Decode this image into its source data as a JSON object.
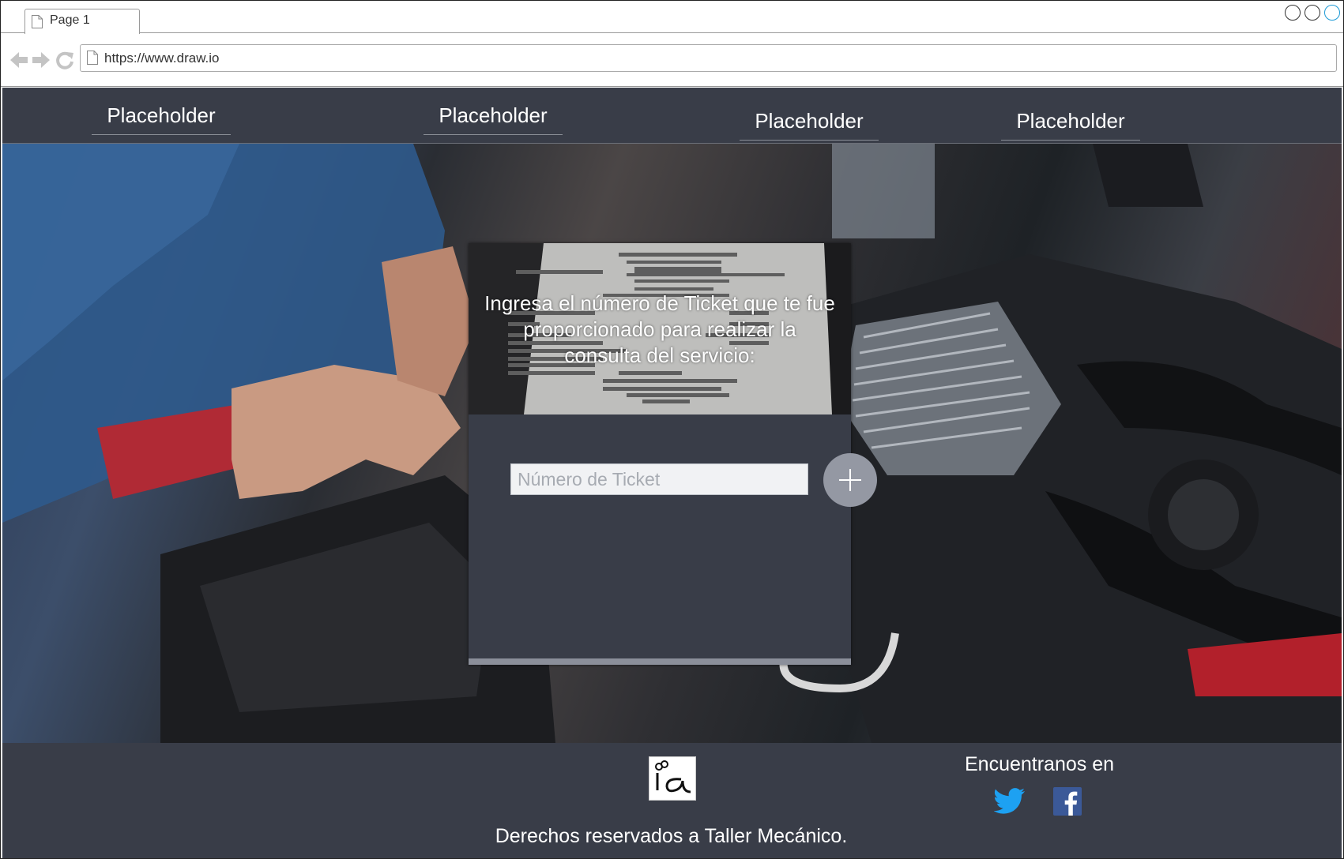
{
  "browser": {
    "tab_label": "Page 1",
    "url": "https://www.draw.io"
  },
  "nav": {
    "items": [
      "Placeholder",
      "Placeholder",
      "Placeholder",
      "Placeholder"
    ]
  },
  "card": {
    "title": "Ingresa el número de Ticket que te fue proporcionado para realizar la consulta del servicio:",
    "input_placeholder": "Número de Ticket",
    "add_icon": "plus-icon"
  },
  "footer": {
    "find_us": "Encuentranos en",
    "social": [
      "twitter-icon",
      "facebook-icon"
    ],
    "copyright": "Derechos reservados a Taller Mecánico."
  },
  "colors": {
    "nav_bg": "#393d48",
    "card_bg": "#393d48",
    "footer_bg": "#393d48",
    "button_bg": "#9498a3",
    "twitter": "#1da1f2",
    "facebook": "#3b5998"
  }
}
